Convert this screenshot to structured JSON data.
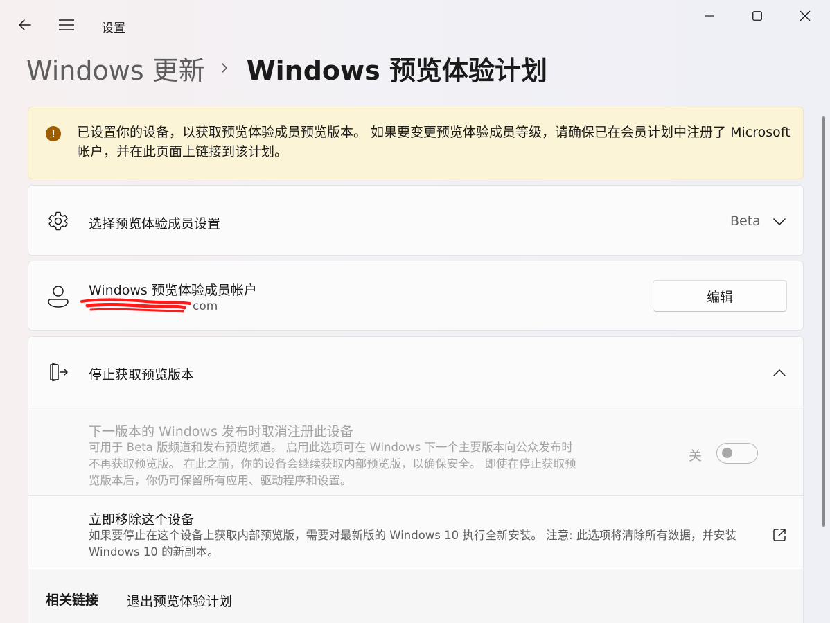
{
  "window": {
    "app_title": "设置",
    "minimize_icon": "minimize-icon",
    "maximize_icon": "maximize-icon",
    "close_icon": "close-icon"
  },
  "nav": {
    "back_icon": "back-arrow-icon",
    "menu_icon": "hamburger-menu-icon"
  },
  "breadcrumb": {
    "parent": "Windows 更新",
    "separator_icon": "chevron-right-icon",
    "current": "Windows 预览体验计划"
  },
  "warning": {
    "icon": "warning-icon",
    "icon_glyph": "!",
    "text": "已设置你的设备，以获取预览体验成员预览版本。 如果要变更预览体验成员等级，请确保已在会员计划中注册了 Microsoft 帐户，并在此页面上链接到该计划。",
    "color": "#9d5d00",
    "background": "#fcf4d6"
  },
  "channel": {
    "icon": "gear-icon",
    "title": "选择预览体验成员设置",
    "value": "Beta",
    "chevron_icon": "chevron-down-icon"
  },
  "account": {
    "icon": "person-icon",
    "title": "Windows 预览体验成员帐户",
    "email": "com",
    "edit_label": "编辑"
  },
  "stop": {
    "icon": "exit-door-icon",
    "title": "停止获取预览版本",
    "chevron_icon": "chevron-up-icon",
    "unenroll": {
      "title": "下一版本的 Windows 发布时取消注册此设备",
      "description": "可用于 Beta 版频道和发布预览频道。 启用此选项可在 Windows 下一个主要版本向公众发布时不再获取预览版。 在此之前，你的设备会继续获取内部预览版，以确保安全。 即使在停止获取预览版本后，你仍可保留所有应用、驱动程序和设置。",
      "toggle_label": "关",
      "toggle_on": false
    },
    "remove": {
      "title": "立即移除这个设备",
      "description": "如果要停止在这个设备上获取内部预览版，需要对最新版的 Windows 10 执行全新安装。 注意: 此选项将清除所有数据，并安装 Windows 10 的新副本。",
      "link_icon": "open-external-icon"
    }
  },
  "related": {
    "label": "相关链接",
    "link": "退出预览体验计划"
  }
}
